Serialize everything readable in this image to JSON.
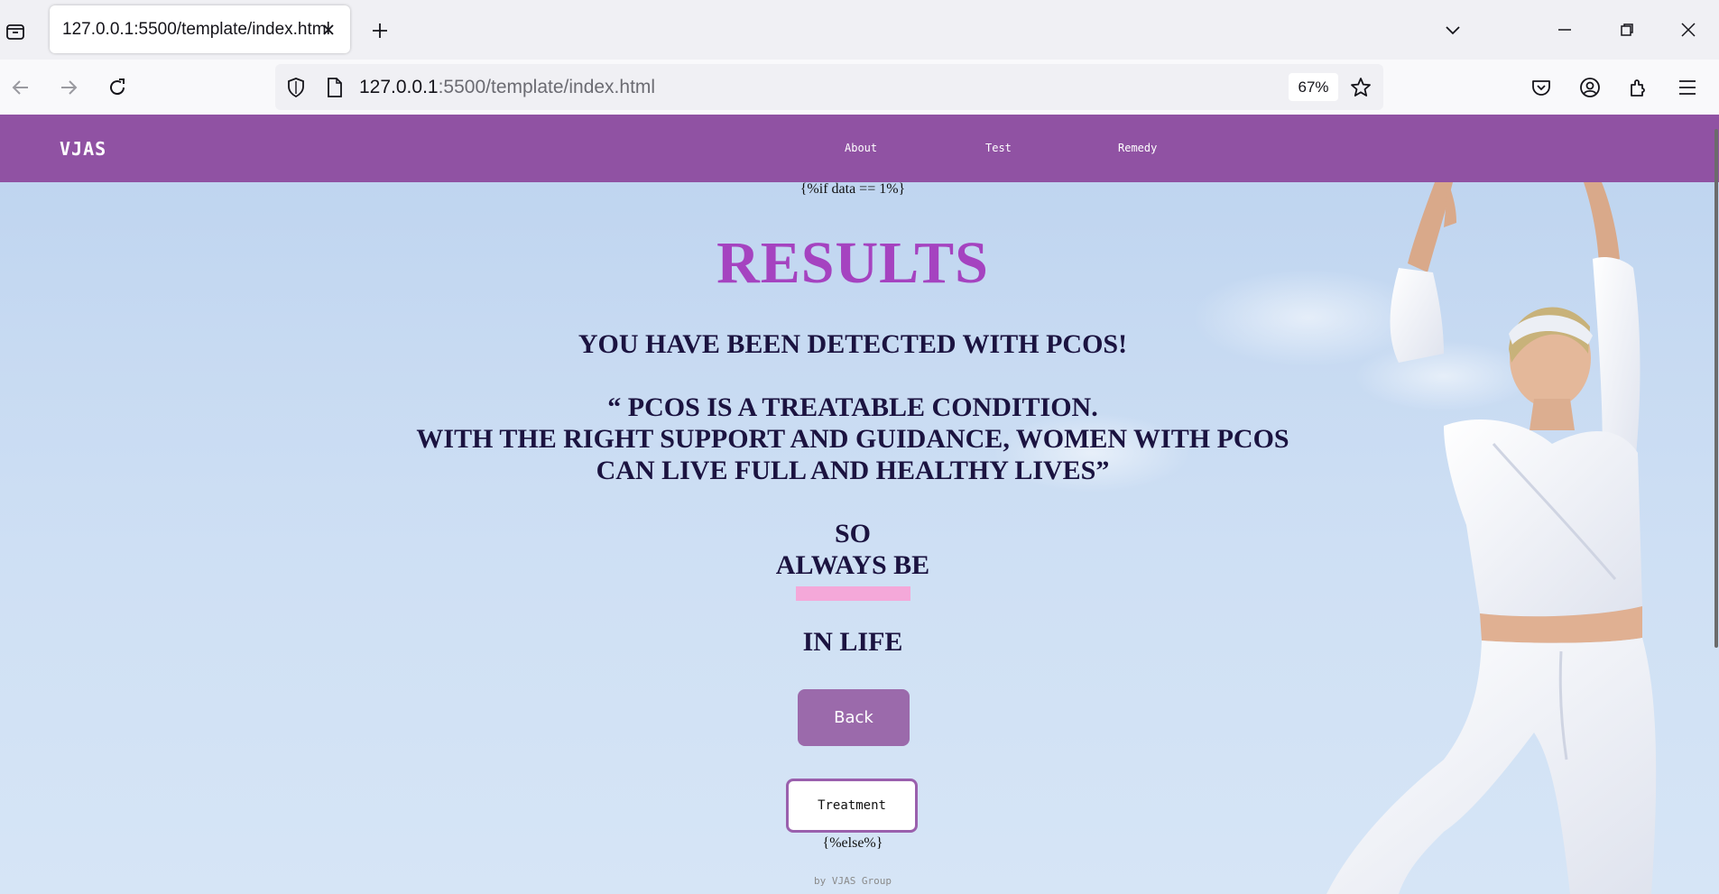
{
  "browser": {
    "tab_title": "127.0.0.1:5500/template/index.html",
    "url_host": "127.0.0.1",
    "url_path": ":5500/template/index.html",
    "zoom": "67%"
  },
  "site": {
    "logo": "VJAS",
    "menu": [
      "About",
      "Test",
      "Remedy"
    ]
  },
  "page": {
    "template_if": "{%if data == 1%}",
    "heading": "RESULTS",
    "detected": "YOU HAVE BEEN DETECTED WITH PCOS!",
    "quote_line1": "“ PCOS IS A TREATABLE CONDITION.",
    "quote_line2": "WITH THE RIGHT SUPPORT AND GUIDANCE, WOMEN WITH PCOS",
    "quote_line3": "CAN LIVE FULL AND HEALTHY LIVES”",
    "so": "SO",
    "always_be": "ALWAYS BE",
    "in_life": "IN LIFE",
    "back_label": "Back",
    "treatment_label": "Treatment",
    "template_else": "{%else%}",
    "footer": "by VJAS Group"
  },
  "colors": {
    "header": "#9052a3",
    "results": "#a543c0",
    "highlight": "#f4a8d9",
    "back_button": "#9b6aab"
  }
}
